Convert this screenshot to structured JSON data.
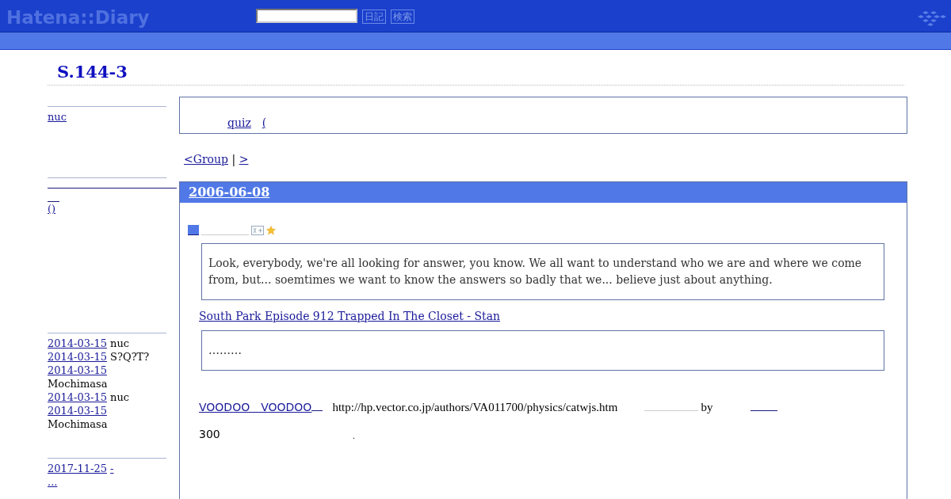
{
  "header": {
    "logo": "Hatena::Diary",
    "buttons": [
      "日記",
      "検索"
    ]
  },
  "title": "S.144-3",
  "sidebar": {
    "profile_link": "nuc",
    "links": [
      "()"
    ],
    "recent_comments": [
      {
        "date": "2014-03-15",
        "author": "nuc"
      },
      {
        "date": "2014-03-15",
        "author": "S?Q?T?"
      },
      {
        "date": "2014-03-15",
        "author": "Mochimasa"
      },
      {
        "date": "2014-03-15",
        "author": "nuc"
      },
      {
        "date": "2014-03-15",
        "author": "Mochimasa"
      }
    ],
    "recent": [
      {
        "date": "2017-11-25",
        "text": "-"
      }
    ],
    "more": "..."
  },
  "intro": {
    "links": [
      "quiz",
      "("
    ]
  },
  "pager": {
    "prev": "<Group",
    "separator": "|",
    "next": ">"
  },
  "entry": {
    "date": "2006-06-08",
    "quote": "Look, everybody, we're all looking for answer, you know. We all want to understand who we are and where we come from, but... soemtimes we want to know the answers so badly that we... believe just about anything.",
    "source": "South Park Episode 912 Trapped In The Closet - Stan",
    "quote2": "………",
    "link": "VOODOO　VOODOO",
    "url": "http://hp.vector.co.jp/authors/VA011700/physics/catwjs.htm",
    "by": "by",
    "count": "300",
    "end": "."
  }
}
